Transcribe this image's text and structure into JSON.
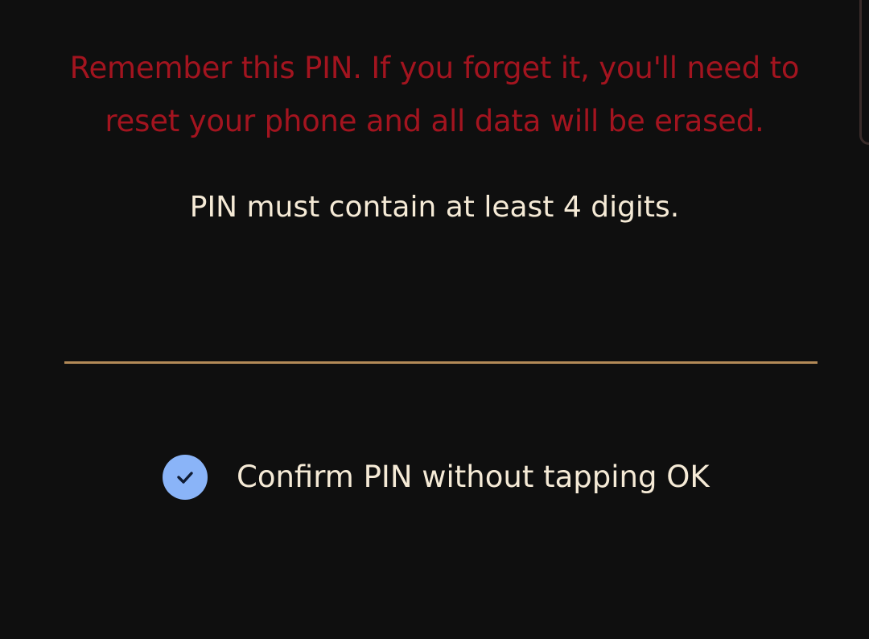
{
  "pin_setup": {
    "warning_line1": "Remember this PIN. If you forget it, you'll need to",
    "warning_line2": "reset your phone and all data will be erased.",
    "requirement_hint": "PIN must contain at least 4 digits.",
    "pin_input_value": "",
    "confirm_option": {
      "label": "Confirm PIN without tapping OK",
      "checked": true,
      "icon": "checkmark-icon"
    }
  },
  "colors": {
    "background": "#0f0f0f",
    "warning_text": "#a3141f",
    "primary_text": "#f5ead6",
    "input_underline": "#b38a57",
    "checkbox_fill": "#8ab4f8",
    "checkmark": "#0f1b33"
  }
}
